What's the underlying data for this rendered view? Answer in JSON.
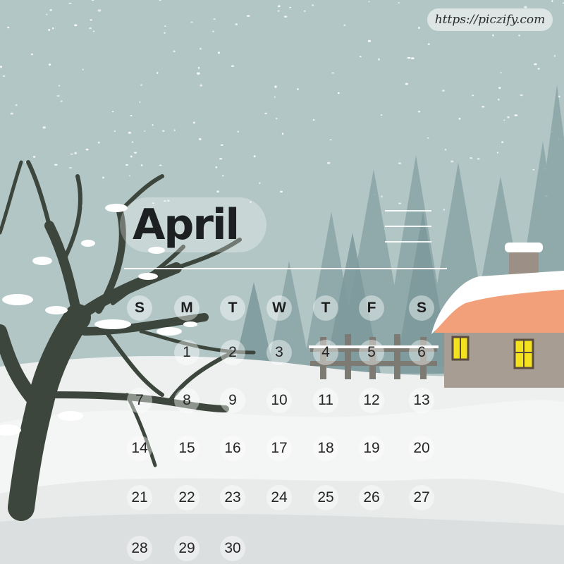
{
  "watermark": "https://piczify.com",
  "calendar": {
    "month": "April",
    "weekdays": [
      "S",
      "M",
      "T",
      "W",
      "T",
      "F",
      "S"
    ],
    "weeks": [
      [
        "",
        "",
        "1",
        "2",
        "3",
        "4",
        "5",
        "6"
      ],
      [
        "7",
        "8",
        "9",
        "10",
        "11",
        "12",
        "13"
      ],
      [
        "14",
        "15",
        "16",
        "17",
        "18",
        "19",
        "20"
      ],
      [
        "21",
        "22",
        "23",
        "24",
        "25",
        "26",
        "27"
      ],
      [
        "28",
        "29",
        "30",
        "",
        "",
        "",
        ""
      ]
    ]
  },
  "colors": {
    "sky": "#b3c6c6",
    "snow": "#f2f3f3",
    "tree_trunk": "#3c463c",
    "pine": "#7f9c9e",
    "house_wall": "#a79d92",
    "roof": "#f2a07a",
    "window": "#f3e21d",
    "text": "#1d2020"
  }
}
